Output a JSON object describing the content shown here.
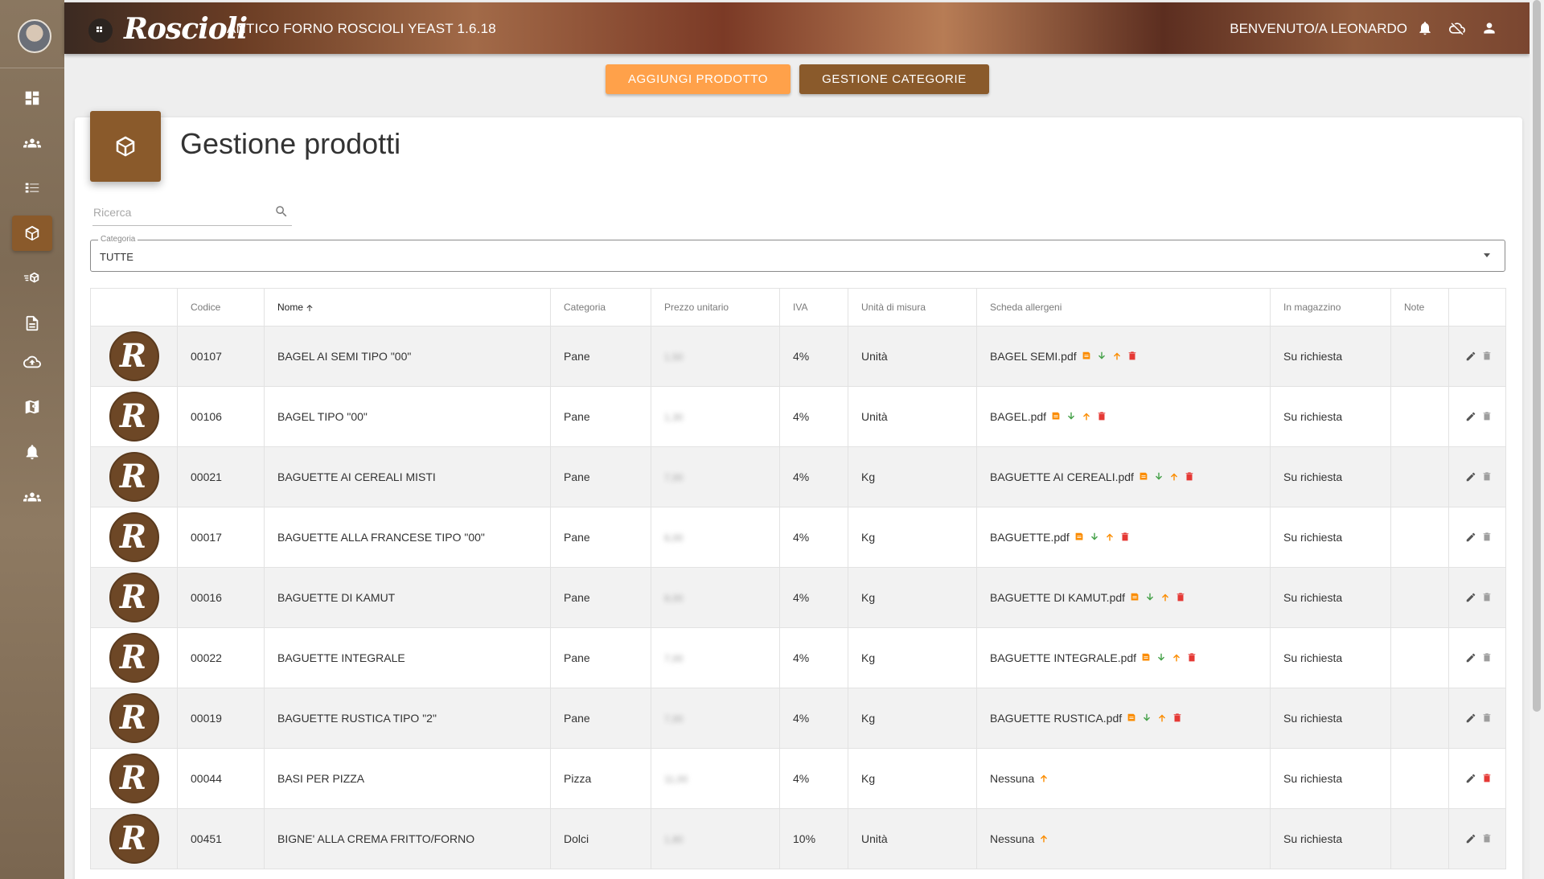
{
  "header": {
    "logo_text": "Roscioli",
    "app_title": "ANTICO FORNO ROSCIOLI YEAST 1.6.18",
    "welcome": "BENVENUTO/A LEONARDO"
  },
  "toolbar": {
    "add_product": "AGGIUNGI PRODOTTO",
    "manage_categories": "GESTIONE CATEGORIE"
  },
  "page": {
    "title": "Gestione prodotti",
    "search_placeholder": "Ricerca",
    "category_label": "Categoria",
    "category_value": "TUTTE"
  },
  "sidebar": {
    "items": [
      "dashboard-icon",
      "clients-icon",
      "orders-icon",
      "products-icon",
      "shipping-icon",
      "document-icon",
      "upload-icon",
      "location-icon",
      "notifications-icon",
      "users-icon"
    ],
    "active": "products-icon"
  },
  "colors": {
    "brand_brown": "#8a5a2b",
    "accent_orange": "#ffa14a",
    "download_green": "#43a047",
    "upload_orange": "#fb8c00",
    "delete_red": "#e53935"
  },
  "table": {
    "columns": [
      "",
      "Codice",
      "Nome",
      "Categoria",
      "Prezzo unitario",
      "IVA",
      "Unità di misura",
      "Scheda allergeni",
      "In magazzino",
      "Note",
      ""
    ],
    "rows": [
      {
        "code": "00107",
        "name": "BAGEL AI SEMI TIPO \"00\"",
        "category": "Pane",
        "price": "1,50",
        "vat": "4%",
        "unit": "Unità",
        "allergen": "BAGEL SEMI.pdf",
        "stock": "Su richiesta",
        "note": ""
      },
      {
        "code": "00106",
        "name": "BAGEL TIPO \"00\"",
        "category": "Pane",
        "price": "1,30",
        "vat": "4%",
        "unit": "Unità",
        "allergen": "BAGEL.pdf",
        "stock": "Su richiesta",
        "note": ""
      },
      {
        "code": "00021",
        "name": "BAGUETTE AI CEREALI MISTI",
        "category": "Pane",
        "price": "7,00",
        "vat": "4%",
        "unit": "Kg",
        "allergen": "BAGUETTE AI CEREALI.pdf",
        "stock": "Su richiesta",
        "note": ""
      },
      {
        "code": "00017",
        "name": "BAGUETTE ALLA FRANCESE TIPO \"00\"",
        "category": "Pane",
        "price": "6,00",
        "vat": "4%",
        "unit": "Kg",
        "allergen": "BAGUETTE.pdf",
        "stock": "Su richiesta",
        "note": ""
      },
      {
        "code": "00016",
        "name": "BAGUETTE DI KAMUT",
        "category": "Pane",
        "price": "8,00",
        "vat": "4%",
        "unit": "Kg",
        "allergen": "BAGUETTE DI KAMUT.pdf",
        "stock": "Su richiesta",
        "note": ""
      },
      {
        "code": "00022",
        "name": "BAGUETTE INTEGRALE",
        "category": "Pane",
        "price": "7,00",
        "vat": "4%",
        "unit": "Kg",
        "allergen": "BAGUETTE INTEGRALE.pdf",
        "stock": "Su richiesta",
        "note": ""
      },
      {
        "code": "00019",
        "name": "BAGUETTE RUSTICA TIPO \"2\"",
        "category": "Pane",
        "price": "7,00",
        "vat": "4%",
        "unit": "Kg",
        "allergen": "BAGUETTE RUSTICA.pdf",
        "stock": "Su richiesta",
        "note": ""
      },
      {
        "code": "00044",
        "name": "BASI PER PIZZA",
        "category": "Pizza",
        "price": "11,00",
        "vat": "4%",
        "unit": "Kg",
        "allergen": "Nessuna",
        "stock": "Su richiesta",
        "note": ""
      },
      {
        "code": "00451",
        "name": "BIGNE' ALLA CREMA FRITTO/FORNO",
        "category": "Dolci",
        "price": "1,80",
        "vat": "10%",
        "unit": "Unità",
        "allergen": "Nessuna",
        "stock": "Su richiesta",
        "note": ""
      }
    ]
  }
}
